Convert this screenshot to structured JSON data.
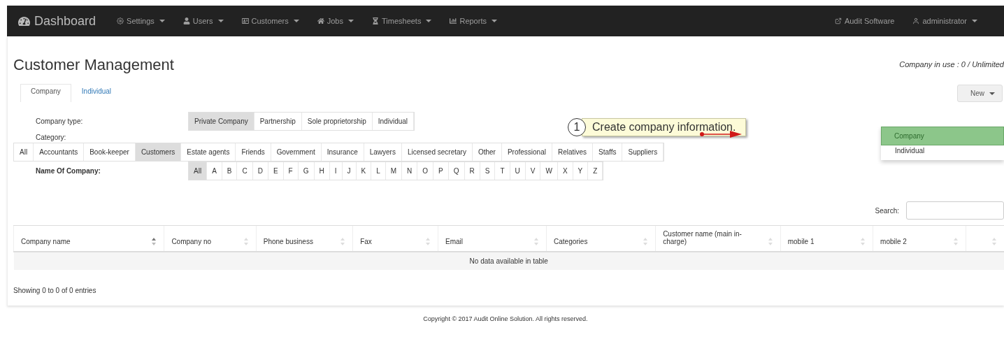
{
  "navbar": {
    "brand": "Dashboard",
    "menus": [
      {
        "label": "Settings"
      },
      {
        "label": "Users"
      },
      {
        "label": "Customers"
      },
      {
        "label": "Jobs"
      },
      {
        "label": "Timesheets"
      },
      {
        "label": "Reports"
      }
    ],
    "right": [
      {
        "label": "Audit Software",
        "dropdown": false
      },
      {
        "label": "administrator",
        "dropdown": true
      }
    ]
  },
  "page": {
    "title": "Customer Management",
    "company_in_use": "Company in use : 0 / Unlimited"
  },
  "tabs": [
    {
      "label": "Company",
      "selected": true
    },
    {
      "label": "Individual",
      "selected": false
    }
  ],
  "new_button": {
    "label": "New"
  },
  "new_menu": [
    {
      "label": "Company",
      "selected": true
    },
    {
      "label": "Individual",
      "selected": false
    }
  ],
  "callout": {
    "number": "1",
    "text": "Create company information."
  },
  "company_type": {
    "label": "Company type:",
    "options": [
      {
        "label": "Private Company",
        "selected": true
      },
      {
        "label": "Partnership",
        "selected": false
      },
      {
        "label": "Sole proprietorship",
        "selected": false
      },
      {
        "label": "Individual",
        "selected": false
      }
    ]
  },
  "category": {
    "label": "Category:",
    "options": [
      {
        "label": "All",
        "selected": false
      },
      {
        "label": "Accountants",
        "selected": false
      },
      {
        "label": "Book-keeper",
        "selected": false
      },
      {
        "label": "Customers",
        "selected": true
      },
      {
        "label": "Estate agents",
        "selected": false
      },
      {
        "label": "Friends",
        "selected": false
      },
      {
        "label": "Government",
        "selected": false
      },
      {
        "label": "Insurance",
        "selected": false
      },
      {
        "label": "Lawyers",
        "selected": false
      },
      {
        "label": "Licensed secretary",
        "selected": false
      },
      {
        "label": "Other",
        "selected": false
      },
      {
        "label": "Professional",
        "selected": false
      },
      {
        "label": "Relatives",
        "selected": false
      },
      {
        "label": "Staffs",
        "selected": false
      },
      {
        "label": "Suppliers",
        "selected": false
      }
    ]
  },
  "name_of_company": {
    "label": "Name Of Company:",
    "letters": [
      {
        "label": "All",
        "selected": true
      },
      {
        "label": "A",
        "selected": false
      },
      {
        "label": "B",
        "selected": false
      },
      {
        "label": "C",
        "selected": false
      },
      {
        "label": "D",
        "selected": false
      },
      {
        "label": "E",
        "selected": false
      },
      {
        "label": "F",
        "selected": false
      },
      {
        "label": "G",
        "selected": false
      },
      {
        "label": "H",
        "selected": false
      },
      {
        "label": "I",
        "selected": false
      },
      {
        "label": "J",
        "selected": false
      },
      {
        "label": "K",
        "selected": false
      },
      {
        "label": "L",
        "selected": false
      },
      {
        "label": "M",
        "selected": false
      },
      {
        "label": "N",
        "selected": false
      },
      {
        "label": "O",
        "selected": false
      },
      {
        "label": "P",
        "selected": false
      },
      {
        "label": "Q",
        "selected": false
      },
      {
        "label": "R",
        "selected": false
      },
      {
        "label": "S",
        "selected": false
      },
      {
        "label": "T",
        "selected": false
      },
      {
        "label": "U",
        "selected": false
      },
      {
        "label": "V",
        "selected": false
      },
      {
        "label": "W",
        "selected": false
      },
      {
        "label": "X",
        "selected": false
      },
      {
        "label": "Y",
        "selected": false
      },
      {
        "label": "Z",
        "selected": false
      }
    ]
  },
  "search": {
    "label": "Search:"
  },
  "table": {
    "columns": [
      {
        "label": "Company name",
        "sorted": true
      },
      {
        "label": "Company no",
        "sorted": false
      },
      {
        "label": "Phone business",
        "sorted": false
      },
      {
        "label": "Fax",
        "sorted": false
      },
      {
        "label": "Email",
        "sorted": false
      },
      {
        "label": "Categories",
        "sorted": false
      },
      {
        "label": "Customer name (main in-charge)",
        "sorted": false
      },
      {
        "label": "mobile 1",
        "sorted": false
      },
      {
        "label": "mobile 2",
        "sorted": false
      },
      {
        "sorted": false
      }
    ],
    "empty_message": "No data available in table"
  },
  "info": "Showing 0 to 0 of 0 entries",
  "footer": "Copyright © 2017 Audit Online Solution. All rights reserved."
}
